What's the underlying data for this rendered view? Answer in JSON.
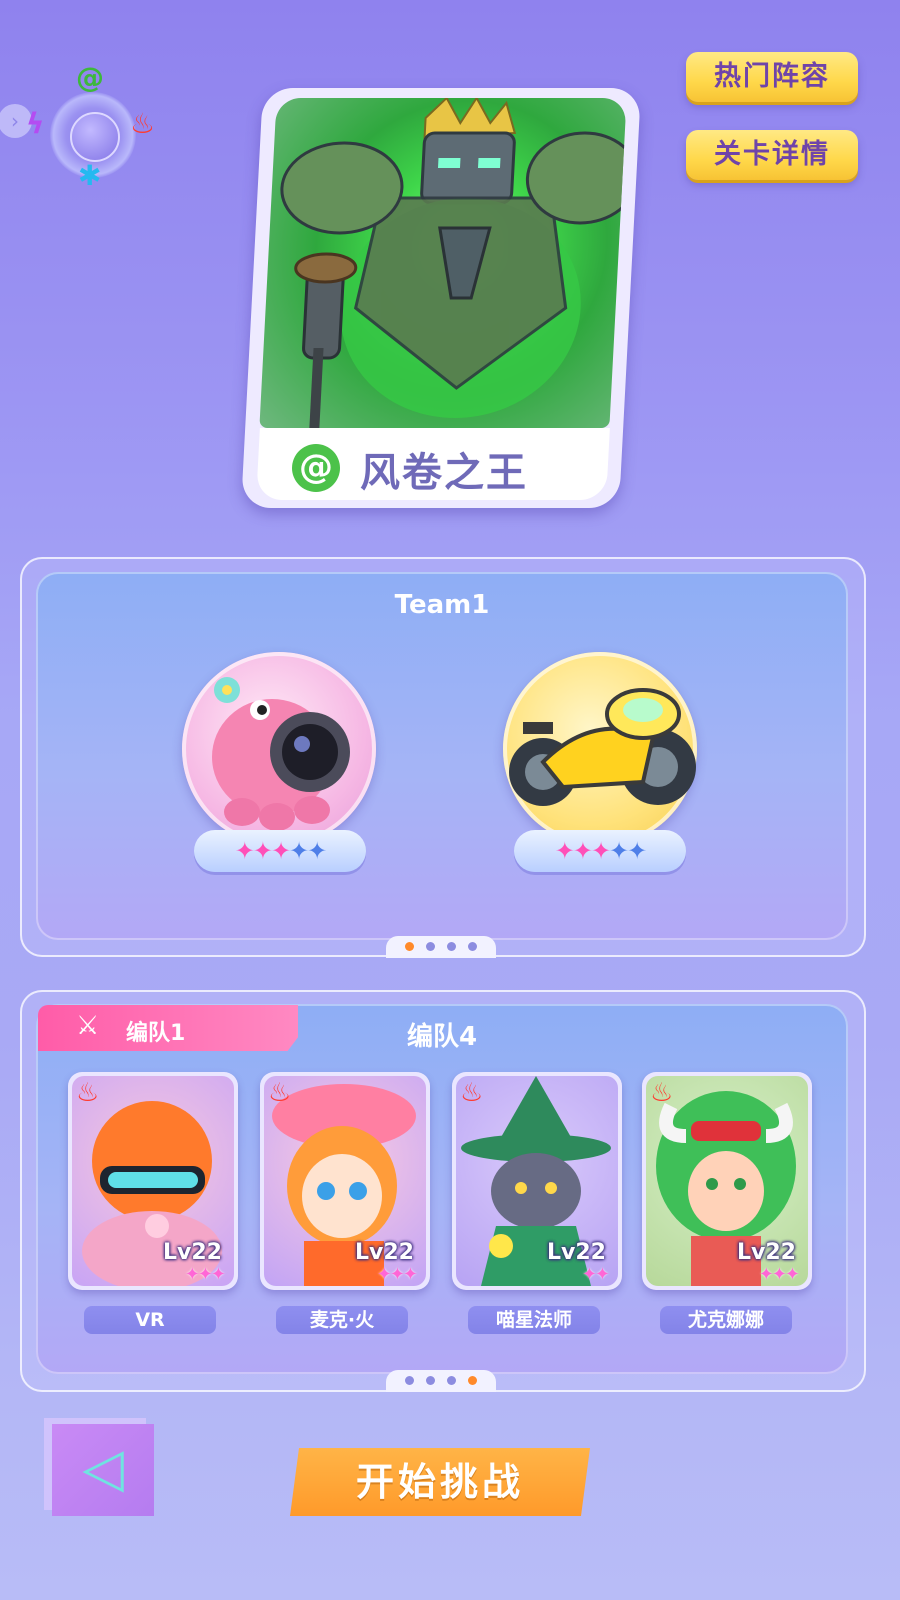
{
  "top_buttons": {
    "hot_lineup": "热门阵容",
    "stage_details": "关卡详情"
  },
  "element_wheel": {
    "elements": [
      "wind-icon",
      "lightning-icon",
      "fire-icon",
      "ice-icon"
    ]
  },
  "boss": {
    "name": "风卷之王",
    "element": "wind"
  },
  "team_panel": {
    "title": "Team1",
    "pets": [
      {
        "name": "pink-octopus-camera",
        "stars_on": 3,
        "stars_total": 5
      },
      {
        "name": "yellow-motorcycle",
        "stars_on": 3,
        "stars_total": 5
      }
    ],
    "page_active": 1,
    "page_count": 4
  },
  "formation_panel": {
    "active_tab": "编队1",
    "title": "编队4",
    "heroes": [
      {
        "name": "VR",
        "level": "Lv22",
        "stars": 3,
        "element": "fire"
      },
      {
        "name": "麦克·火",
        "level": "Lv22",
        "stars": 3,
        "element": "fire"
      },
      {
        "name": "喵星法师",
        "level": "Lv22",
        "stars": 2,
        "element": "fire"
      },
      {
        "name": "尤克娜娜",
        "level": "Lv22",
        "stars": 3,
        "element": "fire"
      }
    ],
    "page_active": 4,
    "page_count": 4
  },
  "bottom": {
    "start_label": "开始挑战"
  }
}
